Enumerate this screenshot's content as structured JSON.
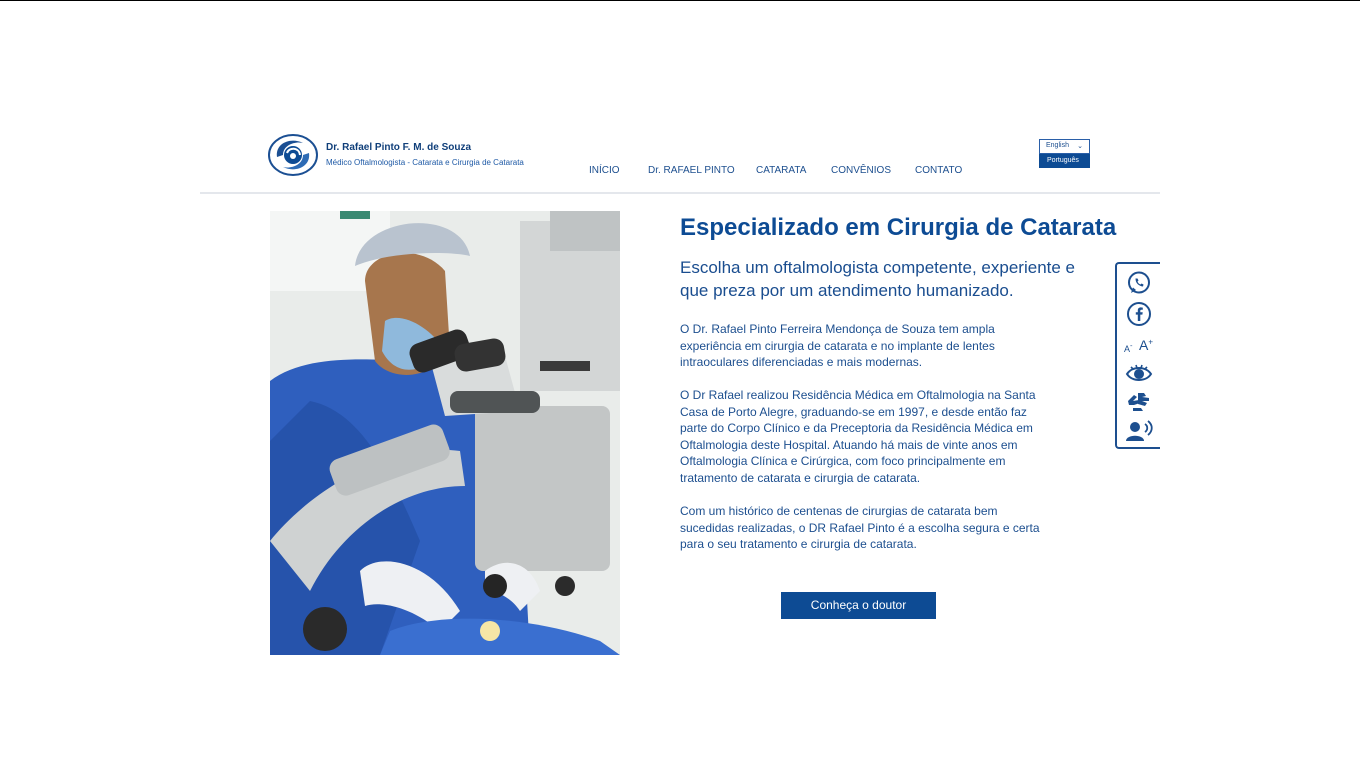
{
  "header": {
    "brand_name": "Dr. Rafael Pinto F. M. de Souza",
    "brand_sub": "Médico Oftalmologista - Catarata e Cirurgia de Catarata",
    "nav": [
      "INÍCIO",
      "Dr. RAFAEL PINTO",
      "CATARATA",
      "CONVÊNIOS",
      "CONTATO"
    ],
    "language": {
      "selected": "English",
      "option": "Português"
    }
  },
  "main": {
    "headline": "Especializado em Cirurgia de Catarata",
    "subhead": "Escolha um oftalmologista competente, experiente e que preza por um atendimento humanizado.",
    "paragraphs": [
      "O Dr. Rafael Pinto Ferreira Mendonça de Souza tem ampla experiência em cirurgia de catarata e no implante de lentes intraoculares diferenciadas e mais modernas.",
      "O Dr Rafael realizou Residência Médica em Oftalmologia na Santa Casa de Porto Alegre, graduando-se em 1997, e desde então faz parte do Corpo Clínico e da Preceptoria da Residência Médica em Oftalmologia deste Hospital. Atuando há mais de vinte anos em Oftalmologia Clínica e Cirúrgica, com foco principalmente em tratamento de catarata e cirurgia de catarata.",
      "Com um histórico de centenas de cirurgias de catarata bem sucedidas realizadas, o DR Rafael Pinto é a escolha segura e certa para o seu tratamento e cirurgia de catarata."
    ],
    "cta": "Conheça o doutor"
  },
  "accessibility": {
    "font_decrease": "A",
    "font_decrease_sign": "-",
    "font_increase": "A",
    "font_increase_sign": "+",
    "icons": [
      "whatsapp-icon",
      "facebook-icon",
      "font-size-icon",
      "contrast-eye-icon",
      "sign-language-icon",
      "screen-reader-icon"
    ]
  },
  "colors": {
    "primary": "#0d4b94",
    "text": "#1d4f8f",
    "rule": "#e4e7ec"
  }
}
